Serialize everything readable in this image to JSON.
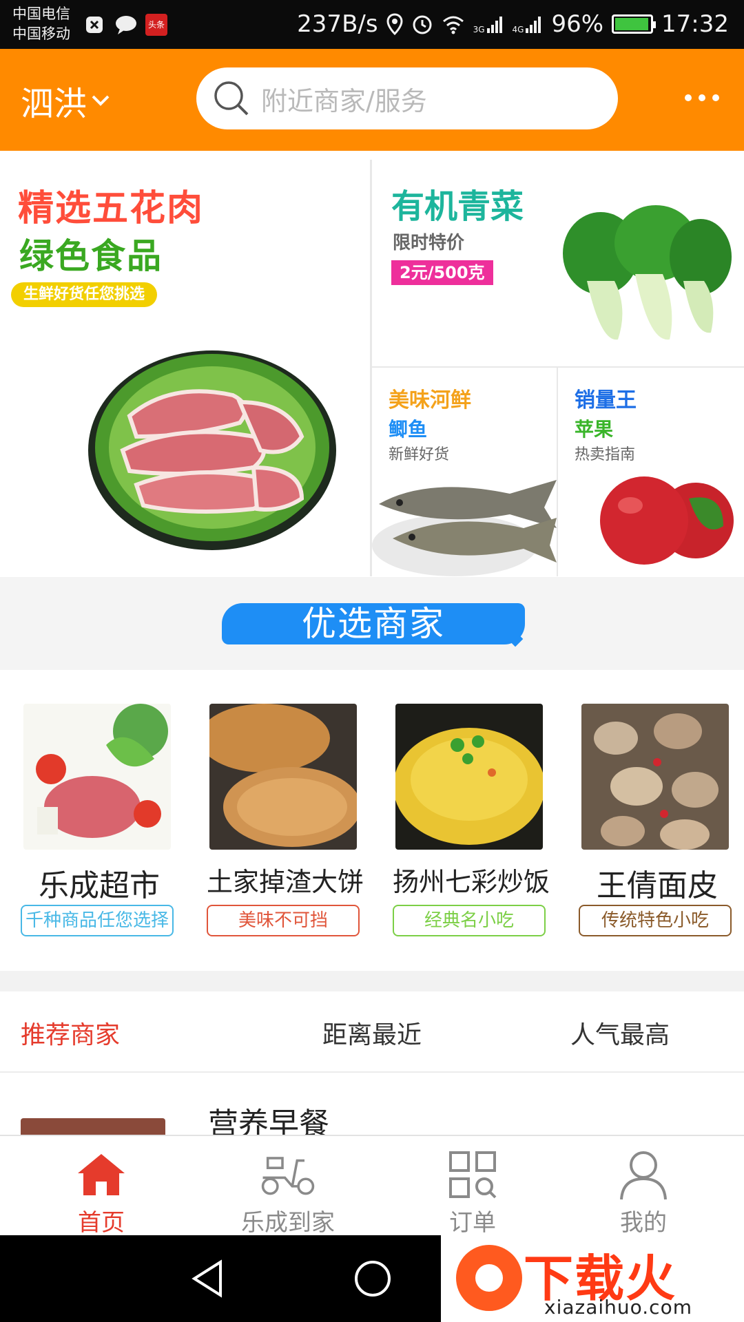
{
  "status_bar": {
    "carrier_1": "中国电信",
    "carrier_2": "中国移动",
    "app_badge_toutiao": "头条",
    "network_speed": "237B/s",
    "signal_1_label": "3G",
    "signal_2_label": "4G",
    "battery_text": "96%",
    "battery_level": 0.96,
    "time": "17:32",
    "icons": [
      "location-icon",
      "alarm-icon",
      "wifi-icon",
      "signal-icon",
      "battery-icon"
    ]
  },
  "header": {
    "city": "泗洪",
    "search_placeholder": "附近商家/服务",
    "accent_color": "#ff8a00"
  },
  "promo": {
    "main": {
      "title": "精选五花肉",
      "subtitle": "绿色食品",
      "tag": "生鲜好货任您挑选"
    },
    "vegetable": {
      "title": "有机青菜",
      "subtitle": "限时特价",
      "price": "2元/500克"
    },
    "fish": {
      "title": "美味河鲜",
      "name": "鲫鱼",
      "desc": "新鲜好货"
    },
    "apple": {
      "title": "销量王",
      "name": "苹果",
      "desc": "热卖指南"
    }
  },
  "section": {
    "title": "优选商家"
  },
  "merchants": [
    {
      "name": "乐成超市",
      "tag": "千种商品任您选择",
      "tag_color": "#48b8e6"
    },
    {
      "name": "土家掉渣大饼",
      "tag": "美味不可挡",
      "tag_color": "#e0553a"
    },
    {
      "name": "扬州七彩炒饭",
      "tag": "经典名小吃",
      "tag_color": "#7ccf46"
    },
    {
      "name": "王倩面皮",
      "tag": "传统特色小吃",
      "tag_color": "#8a5a2a"
    }
  ],
  "sort_tabs": [
    {
      "label": "推荐商家",
      "active": true
    },
    {
      "label": "距离最近",
      "active": false
    },
    {
      "label": "人气最高",
      "active": false
    }
  ],
  "list_preview": {
    "title": "营养早餐"
  },
  "bottom_nav": [
    {
      "label": "首页",
      "icon": "home-icon",
      "active": true
    },
    {
      "label": "乐成到家",
      "icon": "scooter-icon",
      "active": false
    },
    {
      "label": "订单",
      "icon": "orders-icon",
      "active": false
    },
    {
      "label": "我的",
      "icon": "user-icon",
      "active": false
    }
  ],
  "watermark": {
    "brand": "下载火",
    "url": "xiazaihuo.com"
  }
}
